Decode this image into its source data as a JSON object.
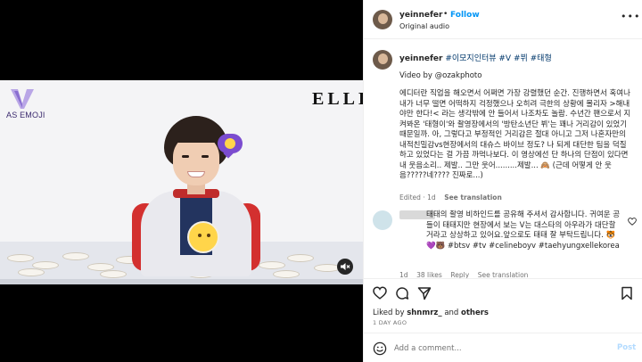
{
  "media": {
    "brand_logo_text": "AS EMOJI",
    "magazine_logo": "ELLE",
    "mute_icon": "speaker-muted-icon"
  },
  "header": {
    "username": "yeinnefer",
    "separator": "•",
    "follow_label": "Follow",
    "audio_label": "Original audio",
    "more_icon": "more-horizontal-icon",
    "more_label": "•••"
  },
  "caption": {
    "username": "yeinnefer",
    "hashtags_line": "#이모지인터뷰 #V #뷔 #태형",
    "video_credit": "Video by @ozakphoto",
    "body": "에디터란 직업을 해오면서 어쩌면 가장 강렬했던 순간. 진행하면서 혹여나 내가 너무 떨면 어떡하지 걱정했으나 오히려 극한의 상황에 몰리자 >해내야만 한다!< 라는 생각밖에 안 들어서 나조차도 놀람. 수년간 팬으로서 지켜봐온 '태형이'와 촬영장에서의 '방탄소년단 뷔'는 꽤나 거리감이 있었기 때문일까. 아, 그렇다고 부정적인 거리감은 절대 아니고 그저 나혼자만의 내적친밀감vs현장에서의 대슈스 바이브 정도? 나 되게 대단한 팀을 덕질하고 있었다는 걸 가끔 까먹나보다. 이 영상에선 단 하나의 단점이 있다면 내 웃음소리.. 제발.. 그만 웃어.........제발... 🙈 (근데 어떻게 안 웃음?????네???? 진짜로...)",
    "edited_label": "Edited",
    "time_label": "1d",
    "see_translation": "See translation"
  },
  "comment": {
    "text": "태태의 촬영 비하인드를 공유해 주셔서 감사합니다. 귀여운 공들이 태태지만 현장에서 보는 V는 대스타의 아우라가 대단할 거라고 상상하고 있어요.앞으로도 태태 잘 부탁드립니다. 🐯💜🐻 #btsv #tv #celineboyv #taehyungxellekorea",
    "time_label": "1d",
    "likes_label": "38 likes",
    "reply_label": "Reply",
    "see_translation": "See translation"
  },
  "actions": {
    "like_icon": "heart-icon",
    "comment_icon": "comment-icon",
    "share_icon": "send-icon",
    "save_icon": "bookmark-icon"
  },
  "likes": {
    "prefix": "Liked by",
    "user": "shnmrz_",
    "conjunction": "and",
    "others": "others"
  },
  "date": "1 DAY AGO",
  "add_comment": {
    "placeholder": "Add a comment...",
    "post_label": "Post",
    "emoji_icon": "smiley-icon"
  },
  "colors": {
    "accent_blue": "#0095f6",
    "hashtag_blue": "#00376b",
    "post_disabled": "#b3dbff",
    "muted_text": "#737373"
  }
}
